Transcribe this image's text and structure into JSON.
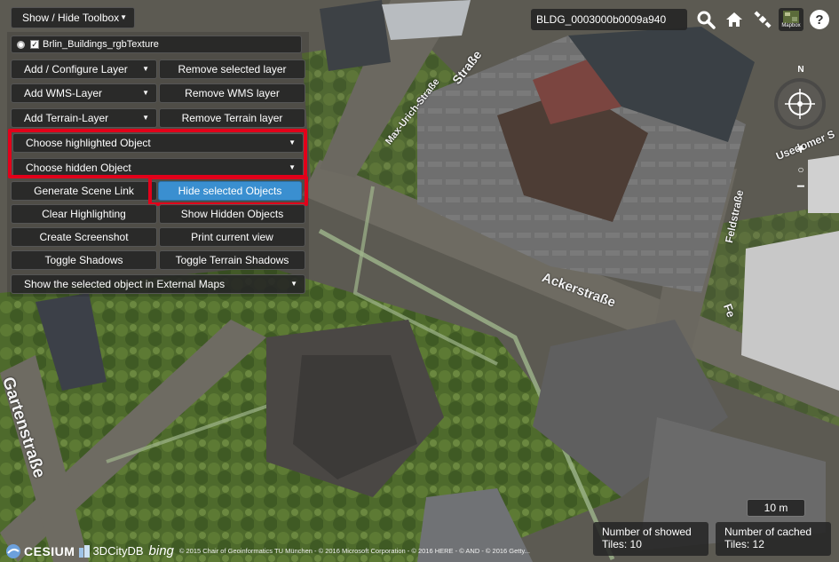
{
  "toolbox": {
    "toggle_label": "Show / Hide Toolbox",
    "layer_name": "Brlin_Buildings_rgbTexture",
    "buttons": {
      "add_layer": "Add / Configure Layer",
      "remove_layer": "Remove selected layer",
      "add_wms": "Add WMS-Layer",
      "remove_wms": "Remove WMS layer",
      "add_terrain": "Add Terrain-Layer",
      "remove_terrain": "Remove Terrain layer",
      "choose_highlighted": "Choose highlighted Object",
      "choose_hidden": "Choose hidden Object",
      "generate_scene_link": "Generate Scene Link",
      "hide_selected": "Hide selected Objects",
      "clear_highlighting": "Clear Highlighting",
      "show_hidden": "Show Hidden Objects",
      "create_screenshot": "Create Screenshot",
      "print_view": "Print current view",
      "toggle_shadows": "Toggle Shadows",
      "toggle_terrain_shadows": "Toggle Terrain Shadows",
      "external_maps": "Show the selected object in External Maps"
    }
  },
  "topbar": {
    "selected_object": "BLDG_0003000b0009a940",
    "icons": [
      "search-icon",
      "home-icon",
      "satellite-icon",
      "base-layer-icon",
      "help-icon"
    ],
    "base_layer_label": "Mapbox"
  },
  "navigation": {
    "compass_letter": "N",
    "zoom_in": "+",
    "zoom_out": "−"
  },
  "scale_label": "10 m",
  "stats": {
    "showed_label": "Number of showed Tiles: 10",
    "cached_label": "Number of cached Tiles: 12"
  },
  "streets": {
    "max_urich": "Max-Urich-Straße",
    "strasse": "Straße",
    "ackerstrasse": "Ackerstraße",
    "gartenstrasse": "Gartenstraße",
    "feldstrasse": "Feldstraße",
    "usedomer": "Usedomer S",
    "fe": "Fe"
  },
  "credits": {
    "cesium": "CESIUM",
    "citydb": "3DCityDB",
    "bing": "bing",
    "text": "© 2015 Chair of Geoinformatics TU München - © 2016 Microsoft Corporation - © 2016 HERE - © AND - © 2016 Getty..."
  },
  "colors": {
    "highlight_red": "#e2001a",
    "primary_blue": "#3a8fd0",
    "panel_dark": "#262626"
  }
}
